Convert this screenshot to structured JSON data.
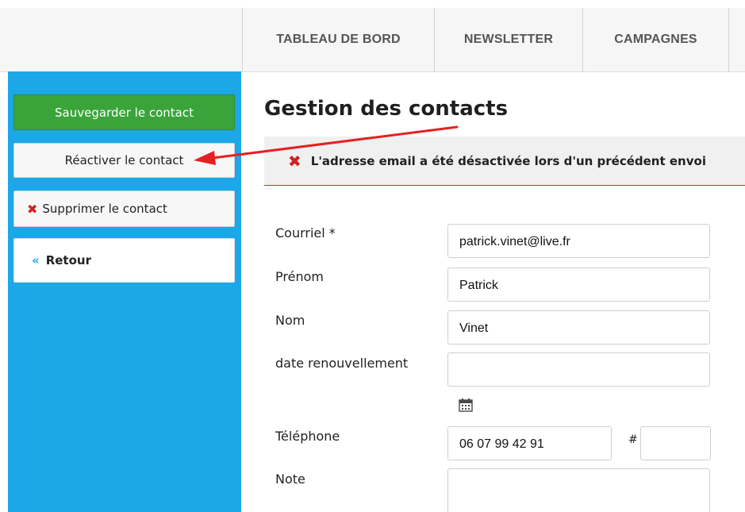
{
  "nav": {
    "tabs": [
      "TABLEAU DE BORD",
      "NEWSLETTER",
      "CAMPAGNES"
    ]
  },
  "sidebar": {
    "save_label": "Sauvegarder le contact",
    "reactivate_label": "Réactiver le contact",
    "delete_label": "Supprimer le contact",
    "back_label": "Retour"
  },
  "main": {
    "title": "Gestion des contacts",
    "alert": "L'adresse email a été désactivée lors d'un précédent envoi",
    "form": {
      "email_label": "Courriel *",
      "email_value": "patrick.vinet@live.fr",
      "firstname_label": "Prénom",
      "firstname_value": "Patrick",
      "lastname_label": "Nom",
      "lastname_value": "Vinet",
      "renewal_label": "date renouvellement",
      "renewal_value": "",
      "phone_label": "Téléphone",
      "phone_value": "06 07 99 42 91",
      "phone_ext_symbol": "#",
      "phone_ext_value": "",
      "note_label": "Note",
      "note_value": ""
    }
  },
  "colors": {
    "sidebar": "#1ba7e8",
    "save_button": "#3aa43a",
    "error": "#d42020",
    "arrow": "#e62020"
  },
  "icons": {
    "delete": "close-icon",
    "back": "double-chevron-left-icon",
    "alert": "close-icon",
    "calendar": "calendar-icon"
  }
}
